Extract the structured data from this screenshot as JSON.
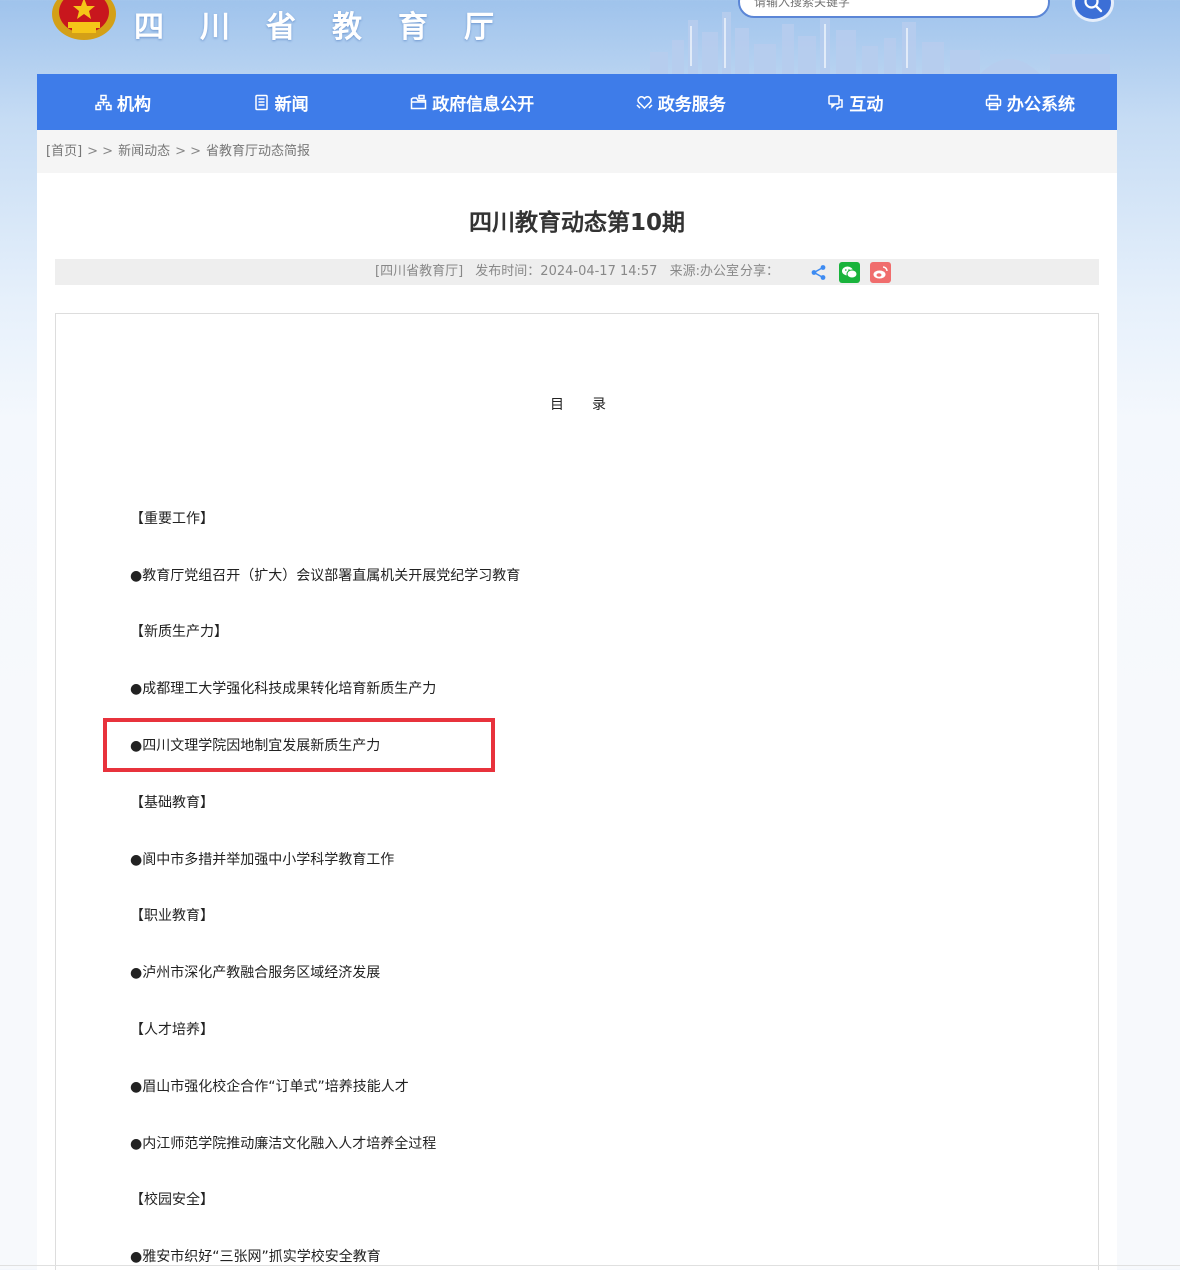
{
  "header": {
    "site_title": "四川省教育厅",
    "search_placeholder": "请输入搜索关键字"
  },
  "colors": {
    "nav_bg": "#3e7ce9",
    "highlight": "#e8323c",
    "wechat": "#19b33c",
    "weibo": "#f06d6d",
    "share": "#3d8bf2"
  },
  "nav": {
    "items": [
      {
        "label": "机构",
        "icon": "org-chart-icon"
      },
      {
        "label": "新闻",
        "icon": "newspaper-icon"
      },
      {
        "label": "政府信息公开",
        "icon": "folder-icon"
      },
      {
        "label": "政务服务",
        "icon": "heart-hand-icon"
      },
      {
        "label": "互动",
        "icon": "chat-icon"
      },
      {
        "label": "办公系统",
        "icon": "printer-icon"
      }
    ]
  },
  "breadcrumb": {
    "home": "[首页]",
    "sep": "> >",
    "level1": "新闻动态",
    "level2": "省教育厅动态简报"
  },
  "article": {
    "title": "四川教育动态第10期",
    "publisher": "[四川省教育厅]",
    "publish_time": "发布时间：2024-04-17 14:57",
    "source": "来源:办公室",
    "share_label": "分享："
  },
  "toc": {
    "title": "目录",
    "lines": [
      "【重要工作】",
      "●教育厅党组召开（扩大）会议部署直属机关开展党纪学习教育",
      "【新质生产力】",
      "●成都理工大学强化科技成果转化培育新质生产力",
      "●四川文理学院因地制宜发展新质生产力",
      "【基础教育】",
      "●阆中市多措并举加强中小学科学教育工作",
      "【职业教育】",
      "●泸州市深化产教融合服务区域经济发展",
      "【人才培养】",
      "●眉山市强化校企合作“订单式”培养技能人才",
      "●内江师范学院推动廉洁文化融入人才培养全过程",
      "【校园安全】",
      "●雅安市织好“三张网”抓实学校安全教育"
    ]
  }
}
